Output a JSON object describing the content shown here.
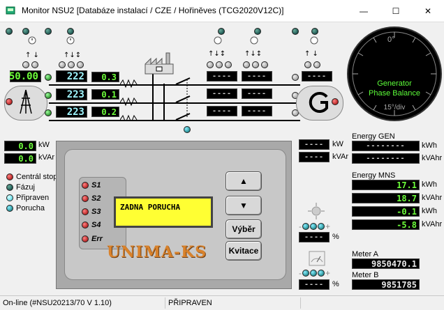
{
  "window": {
    "title": "Monitor NSU2 [Databáze instalací / CZE / Hořiněves (TCG2020V12C)]",
    "minimize_glyph": "—",
    "maximize_glyph": "☐",
    "close_glyph": "✕"
  },
  "mains": {
    "frequency": "50.00",
    "voltages": [
      "222",
      "223",
      "223"
    ],
    "currents": [
      "0.3",
      "0.1",
      "0.2"
    ]
  },
  "power": {
    "kw_value": "0.0",
    "kw_unit": "kW",
    "kvar_value": "0.0",
    "kvar_unit": "kVAr",
    "gen_kw_value": "----",
    "gen_kw_unit": "kW",
    "gen_kvar_value": "----",
    "gen_kvar_unit": "kVAr"
  },
  "gauge": {
    "top_label": "0°",
    "title_line1": "Generator",
    "title_line2": "Phase Balance",
    "scale": "15°/div"
  },
  "legend": {
    "items": [
      {
        "label": "Centrál stop",
        "color": "red"
      },
      {
        "label": "Fázuj",
        "color": "dgreen"
      },
      {
        "label": "Připraven",
        "color": "cyanb"
      },
      {
        "label": "Porucha",
        "color": "teal"
      }
    ]
  },
  "controller": {
    "s_labels": [
      "S1",
      "S2",
      "S3",
      "S4",
      "Err"
    ],
    "display_text": "ZADNA PORUCHA",
    "up_glyph": "▲",
    "down_glyph": "▼",
    "vyber_label": "Výběr",
    "kvitace_label": "Kvitace",
    "brand": "UNIMA-KS"
  },
  "percent": {
    "unit": "%",
    "value1": "----",
    "value2": "----"
  },
  "energy_gen": {
    "title": "Energy GEN",
    "kwh_value": "--------",
    "kwh_unit": "kWh",
    "kvarh_value": "--------",
    "kvarh_unit": "kVAhr"
  },
  "energy_mns": {
    "title": "Energy MNS",
    "rows": [
      {
        "value": "17.1",
        "unit": "kWh"
      },
      {
        "value": "18.7",
        "unit": "kVAhr"
      },
      {
        "value": "-0.1",
        "unit": "kWh"
      },
      {
        "value": "-5.8",
        "unit": "kVAhr"
      }
    ]
  },
  "meters": {
    "a_label": "Meter A",
    "a_value": "9850470.1",
    "b_label": "Meter B",
    "b_value": "9851785"
  },
  "status_bar": {
    "connection": "On-line  (#NSU20213/70  V 1.10)",
    "state": "PŘIPRAVEN"
  },
  "icons": [
    "app-icon",
    "transformer-icon",
    "generator-icon",
    "factory-icon",
    "fan-icon",
    "meter-icon",
    "clock-icon"
  ]
}
